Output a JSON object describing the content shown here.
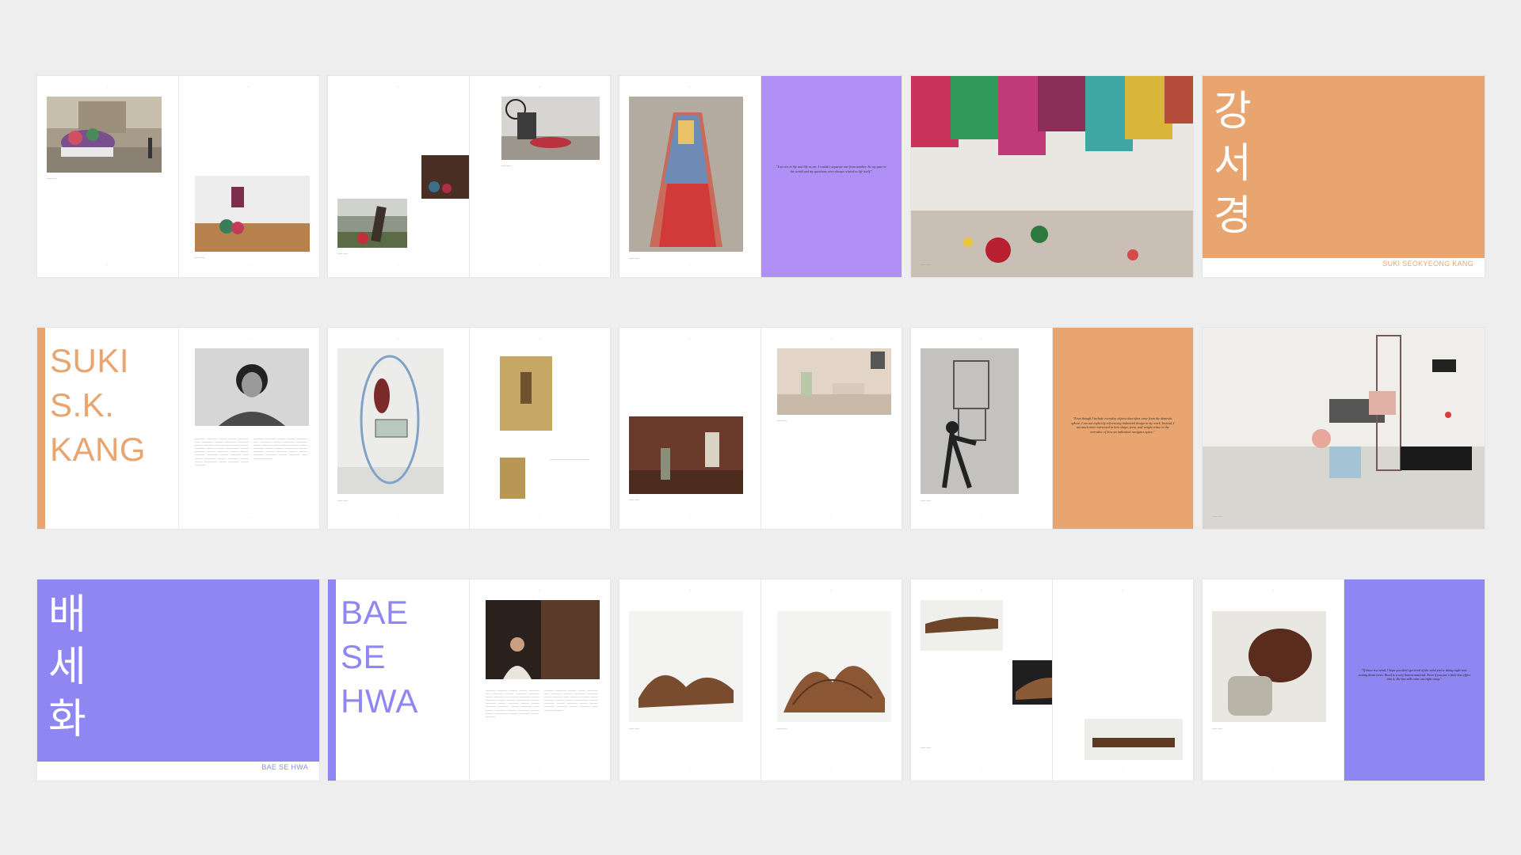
{
  "colors": {
    "background": "#eeeeee",
    "purple": "#8f87f1",
    "lavender": "#b08ff6",
    "orange": "#e9a56f"
  },
  "suki": {
    "hangul": [
      "강",
      "서",
      "경"
    ],
    "banner_name": "SUKI SEOKYEONG KANG",
    "title_lines": [
      "SUKI",
      "S.K.",
      "KANG"
    ],
    "quote_1": "\"I see art in life and life as art. I couldn't separate one from another. So my gaze to the world and my questions were always related to life itself.\"",
    "quote_2": "\"Even though I include everyday objects that often come from the domestic sphere, I am not explicitly referencing industrial design in my work. Instead, I am much more interested in how shape, form, and weight relate to the narrative of how an individual navigates space.\""
  },
  "bae": {
    "hangul": [
      "배",
      "세",
      "화"
    ],
    "banner_name": "BAE SE HWA",
    "title_lines": [
      "BAE",
      "SE",
      "HWA"
    ],
    "quote": "\"If there is a wind, I hope you don't get tired of the wind you're doing right now cutting down trees. Wood is a very honest material. Even if you put a little less effort into it, the law will come out right away.\""
  }
}
